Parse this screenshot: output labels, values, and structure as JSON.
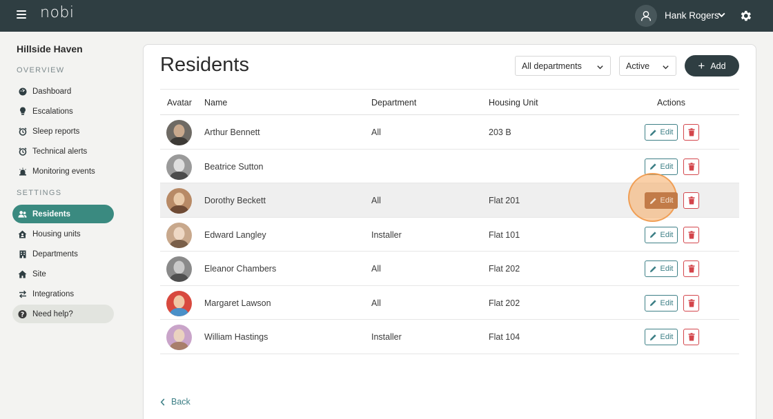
{
  "header": {
    "logo_text": "nobi",
    "user_name": "Hank Rogers",
    "menu_icon": "hamburger-icon",
    "settings_icon": "gear-icon"
  },
  "sidebar": {
    "site_name": "Hillside Haven",
    "overview_label": "OVERVIEW",
    "settings_label": "SETTINGS",
    "overview_items": [
      {
        "label": "Dashboard",
        "icon": "dashboard-icon"
      },
      {
        "label": "Escalations",
        "icon": "lightbulb-icon"
      },
      {
        "label": "Sleep reports",
        "icon": "alarm-clock-icon"
      },
      {
        "label": "Technical alerts",
        "icon": "alarm-clock-icon"
      },
      {
        "label": "Monitoring events",
        "icon": "siren-icon"
      }
    ],
    "settings_items": [
      {
        "label": "Residents",
        "icon": "users-icon",
        "active": true
      },
      {
        "label": "Housing units",
        "icon": "house-user-icon"
      },
      {
        "label": "Departments",
        "icon": "building-icon"
      },
      {
        "label": "Site",
        "icon": "home-icon"
      },
      {
        "label": "Integrations",
        "icon": "arrows-exchange-icon"
      }
    ],
    "help_label": "Need help?"
  },
  "main": {
    "title": "Residents",
    "department_filter": "All departments",
    "status_filter": "Active",
    "add_label": "Add",
    "back_label": "Back",
    "columns": {
      "avatar": "Avatar",
      "name": "Name",
      "department": "Department",
      "housing_unit": "Housing Unit",
      "actions": "Actions"
    },
    "edit_label": "Edit",
    "residents": [
      {
        "name": "Arthur Bennett",
        "department": "All",
        "housing_unit": "203 B"
      },
      {
        "name": "Beatrice Sutton",
        "department": "",
        "housing_unit": ""
      },
      {
        "name": "Dorothy Beckett",
        "department": "All",
        "housing_unit": "Flat 201"
      },
      {
        "name": "Edward Langley",
        "department": "Installer",
        "housing_unit": "Flat 101"
      },
      {
        "name": "Eleanor Chambers",
        "department": "All",
        "housing_unit": "Flat 202"
      },
      {
        "name": "Margaret Lawson",
        "department": "All",
        "housing_unit": "Flat 202"
      },
      {
        "name": "William Hastings",
        "department": "Installer",
        "housing_unit": "Flat 104"
      }
    ]
  },
  "colors": {
    "topbar": "#2f3e42",
    "accent": "#3a8a80",
    "delete": "#d3454b",
    "highlight": "#f6aa60"
  }
}
